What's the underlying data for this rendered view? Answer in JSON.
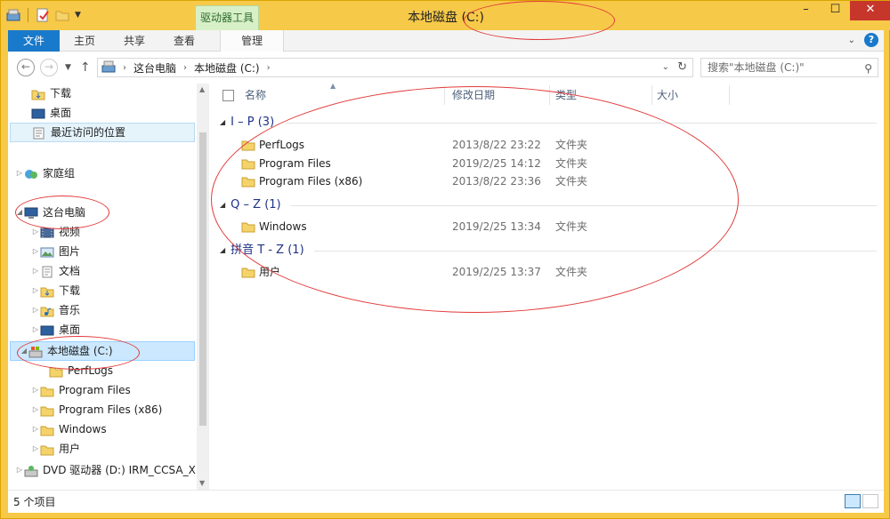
{
  "window": {
    "title": "本地磁盘 (C:)",
    "context_tab": "驱动器工具"
  },
  "ribbon": {
    "tabs": [
      "文件",
      "主页",
      "共享",
      "查看",
      "管理"
    ],
    "help": "?"
  },
  "address": {
    "crumbs": [
      "这台电脑",
      "本地磁盘 (C:)"
    ],
    "search_placeholder": "搜索\"本地磁盘 (C:)\""
  },
  "nav": {
    "items": [
      {
        "label": "下载",
        "icon": "downloads-icon"
      },
      {
        "label": "桌面",
        "icon": "desktop-icon"
      },
      {
        "label": "最近访问的位置",
        "icon": "recent-places-icon"
      },
      {
        "label": "家庭组",
        "icon": "homegroup-icon"
      },
      {
        "label": "这台电脑",
        "icon": "computer-icon"
      },
      {
        "label": "视频",
        "icon": "videos-icon"
      },
      {
        "label": "图片",
        "icon": "pictures-icon"
      },
      {
        "label": "文档",
        "icon": "documents-icon"
      },
      {
        "label": "下载",
        "icon": "downloads-icon"
      },
      {
        "label": "音乐",
        "icon": "music-icon"
      },
      {
        "label": "桌面",
        "icon": "desktop-icon"
      },
      {
        "label": "本地磁盘 (C:)",
        "icon": "drive-icon"
      },
      {
        "label": "PerfLogs",
        "icon": "folder-icon"
      },
      {
        "label": "Program Files",
        "icon": "folder-icon"
      },
      {
        "label": "Program Files (x86)",
        "icon": "folder-icon"
      },
      {
        "label": "Windows",
        "icon": "folder-icon"
      },
      {
        "label": "用户",
        "icon": "folder-icon"
      },
      {
        "label": "DVD 驱动器 (D:) IRM_CCSA_X",
        "icon": "dvd-drive-icon"
      }
    ]
  },
  "columns": {
    "name": "名称",
    "modified": "修改日期",
    "type": "类型",
    "size": "大小"
  },
  "groups": [
    {
      "label": "I – P (3)",
      "rows": [
        {
          "name": "PerfLogs",
          "date": "2013/8/22 23:22",
          "type": "文件夹"
        },
        {
          "name": "Program Files",
          "date": "2019/2/25 14:12",
          "type": "文件夹"
        },
        {
          "name": "Program Files (x86)",
          "date": "2013/8/22 23:36",
          "type": "文件夹"
        }
      ]
    },
    {
      "label": "Q – Z (1)",
      "rows": [
        {
          "name": "Windows",
          "date": "2019/2/25 13:34",
          "type": "文件夹"
        }
      ]
    },
    {
      "label": "拼音 T - Z (1)",
      "rows": [
        {
          "name": "用户",
          "date": "2019/2/25 13:37",
          "type": "文件夹"
        }
      ]
    }
  ],
  "status": {
    "count": "5 个项目"
  },
  "colors": {
    "frame": "#f7c948",
    "file_tab": "#1979ca",
    "group_header": "#1e3287",
    "selection": "#cce8ff",
    "annotation": "#e23a3a"
  }
}
